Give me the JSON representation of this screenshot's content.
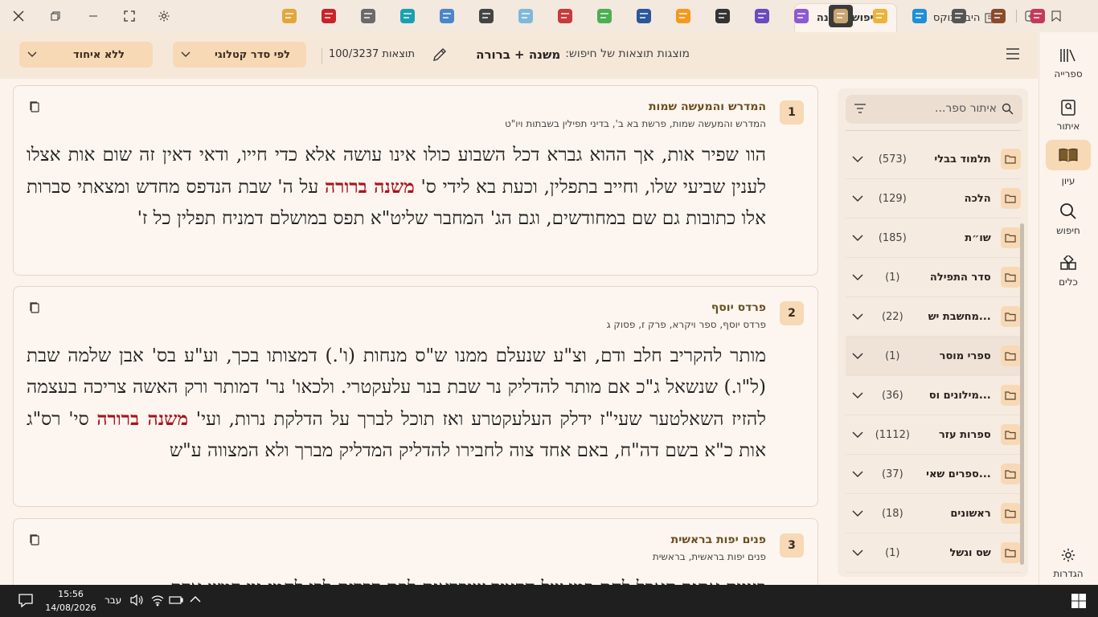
{
  "window": {
    "tabs": [
      {
        "label": "חיפוש: משנה",
        "active": true
      },
      {
        "label": "היברובוקס",
        "active": false
      }
    ]
  },
  "rail": {
    "items": [
      {
        "label": "ספרייה",
        "icon": "library-icon"
      },
      {
        "label": "איתור",
        "icon": "locate-book-icon"
      },
      {
        "label": "עיון",
        "icon": "open-book-icon",
        "active": true
      },
      {
        "label": "חיפוש",
        "icon": "search-icon"
      },
      {
        "label": "כלים",
        "icon": "tools-icon"
      }
    ],
    "settings_label": "הגדרות"
  },
  "header": {
    "prefix": "מוצגות תוצאות של חיפוש:",
    "query": "משנה + ברורה",
    "results": "100/3237 תוצאות",
    "sort_label": "לפי סדר קטלוגי",
    "group_label": "ללא איחוד"
  },
  "sidebar": {
    "search_placeholder": "איתור ספר...",
    "categories": [
      {
        "name": "תלמוד בבלי",
        "count": "(573)"
      },
      {
        "name": "הלכה",
        "count": "(129)"
      },
      {
        "name": "שו״ת",
        "count": "(185)"
      },
      {
        "name": "סדר התפילה",
        "count": "(1)"
      },
      {
        "name": "מחשבת יש...",
        "count": "(22)"
      },
      {
        "name": "ספרי מוסר",
        "count": "(1)",
        "highlighted": true
      },
      {
        "name": "מילונים וס...",
        "count": "(36)"
      },
      {
        "name": "ספרות עזר",
        "count": "(1112)"
      },
      {
        "name": "ספרים שאי...",
        "count": "(37)"
      },
      {
        "name": "ראשונים",
        "count": "(18)"
      },
      {
        "name": "שס וגשל",
        "count": "(1)"
      }
    ]
  },
  "results": [
    {
      "number": "1",
      "title": "המדרש והמעשה שמות",
      "path": "המדרש והמעשה שמות, פרשת בא ב', בדיני תפילין בשבתות ויו\"ט",
      "text_before": "הוו שפיר אות, אך ההוא גברא דכל השבוע כולו אינו עושה אלא כדי חייו, ודאי דאין זה שום אות אצלו לענין שביעי שלו, וחייב בתפלין, וכעת בא לידי ס' ",
      "highlight": "משנה ברורה",
      "text_after": " על ה' שבת הנדפס מחדש ומצאתי סברות אלו כתובות גם שם במחודשים, וגם הג' המחבר שליט\"א תפס במושלם דמניח תפלין כל ז'"
    },
    {
      "number": "2",
      "title": "פרדס יוסף",
      "path": "פרדס יוסף, ספר ויקרא, פרק ז, פסוק ג",
      "text_before": "מותר להקריב חלב ודם, וצ\"ע שנעלם ממנו ש\"ס מנחות (ו'.) דמצותו בכך, וע\"ע בס' אבן שלמה שבת (ל\"ו.) שנשאל ג\"כ אם מותר להדליק נר שבת בנר עלעקטרי. ולכאו' נר' דמותר ורק האשה צריכה בעצמה להזיז השאלטער שעי\"ז ידלק העלעקטרע ואז תוכל לברך על הדלקת נרות, ועי' ",
      "highlight": "משנה ברורה",
      "text_after": " סי' רס\"ג אות כ\"א בשם דה\"ח, באם אחד צוה לחבירו להדליק המדליק מברך ולא המצווה ע\"ש"
    },
    {
      "number": "3",
      "title": "פנים יפות בראשית",
      "path": "פנים יפות בראשית, בראשית",
      "text_before": "בעיות אתנך תאכל לחם כמו של הקציר שיבראים לפת דברים לבו לחמי נין דמש אדם",
      "highlight": "",
      "text_after": ""
    }
  ],
  "taskbar": {
    "time": "15:56",
    "date": "14/08/2026",
    "lang": "עבר"
  }
}
